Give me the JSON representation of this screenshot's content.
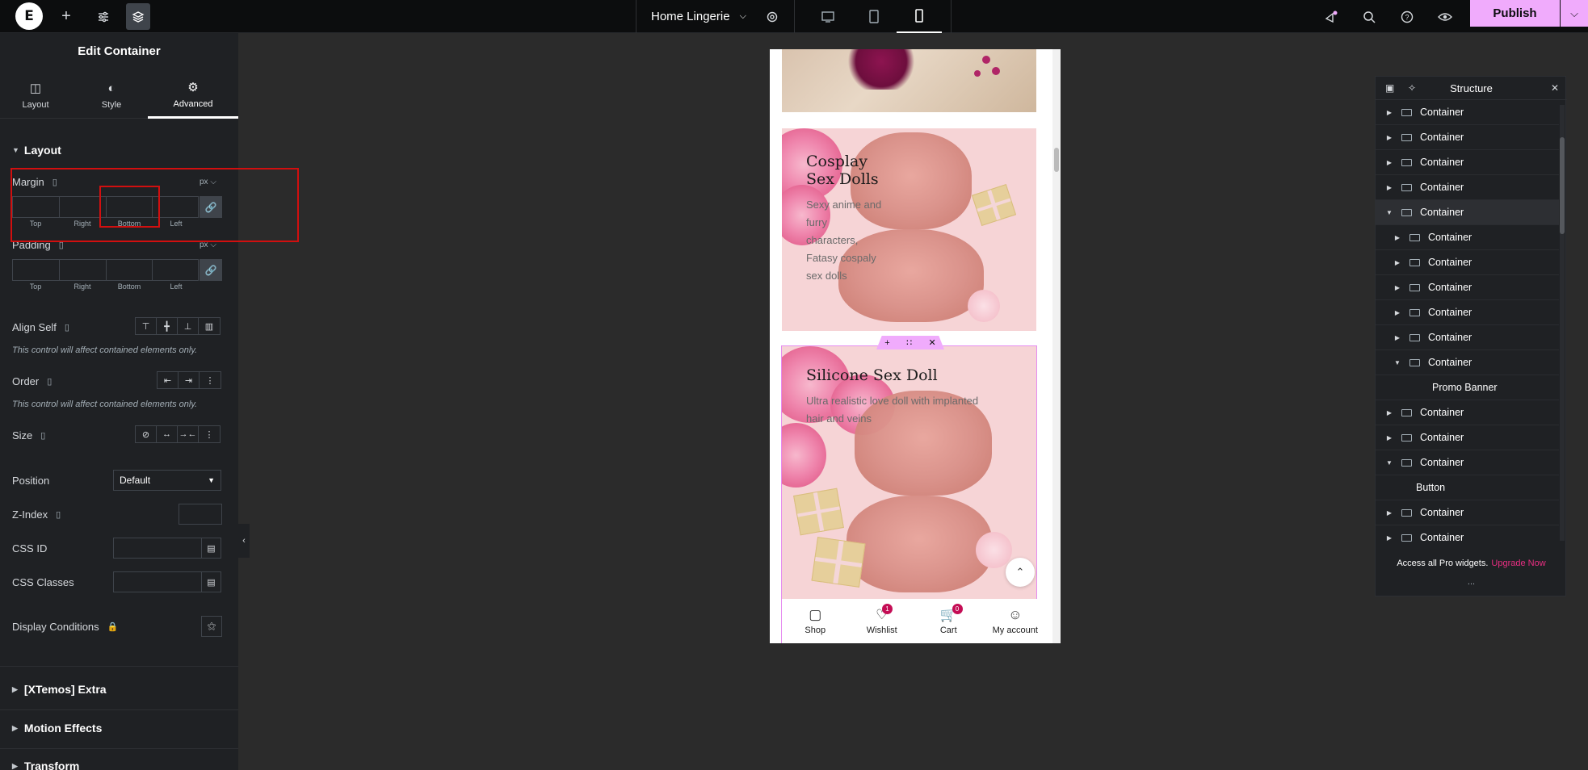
{
  "topbar": {
    "page_title": "Home Lingerie",
    "publish_label": "Publish"
  },
  "panel": {
    "title": "Edit Container",
    "tabs": [
      {
        "label": "Layout",
        "icon": "layout-icon"
      },
      {
        "label": "Style",
        "icon": "style-icon"
      },
      {
        "label": "Advanced",
        "icon": "gear-icon"
      }
    ],
    "section_layout": "Layout",
    "margin": {
      "label": "Margin",
      "unit": "px",
      "sides": [
        "Top",
        "Right",
        "Bottom",
        "Left"
      ]
    },
    "padding": {
      "label": "Padding",
      "unit": "px",
      "sides": [
        "Top",
        "Right",
        "Bottom",
        "Left"
      ]
    },
    "align_self": "Align Self",
    "align_note": "This control will affect contained elements only.",
    "order": "Order",
    "order_note": "This control will affect contained elements only.",
    "size": "Size",
    "position": {
      "label": "Position",
      "value": "Default"
    },
    "z_index": "Z-Index",
    "css_id": "CSS ID",
    "css_classes": "CSS Classes",
    "display_conditions": "Display Conditions",
    "collapsed_sections": [
      "[XTemos] Extra",
      "Motion Effects",
      "Transform"
    ]
  },
  "preview": {
    "card1": {
      "title_line1": "Cosplay",
      "title_line2": "Sex Dolls",
      "desc_lines": [
        "Sexy anime and",
        "furry",
        "characters,",
        "Fatasy cospaly",
        "sex dolls"
      ]
    },
    "card2": {
      "title": "Silicone Sex Doll",
      "desc_line1": "Ultra realistic love doll with implanted",
      "desc_line2": "hair and veins"
    },
    "nav": [
      {
        "label": "Shop",
        "icon": "shop-icon",
        "badge": ""
      },
      {
        "label": "Wishlist",
        "icon": "heart-icon",
        "badge": "1"
      },
      {
        "label": "Cart",
        "icon": "cart-icon",
        "badge": "0"
      },
      {
        "label": "My account",
        "icon": "user-icon",
        "badge": ""
      }
    ]
  },
  "structure": {
    "title": "Structure",
    "rows": [
      {
        "label": "Container",
        "depth": 0,
        "expanded": false
      },
      {
        "label": "Container",
        "depth": 0,
        "expanded": false
      },
      {
        "label": "Container",
        "depth": 0,
        "expanded": false
      },
      {
        "label": "Container",
        "depth": 0,
        "expanded": false
      },
      {
        "label": "Container",
        "depth": 0,
        "expanded": true
      },
      {
        "label": "Container",
        "depth": 1,
        "expanded": false
      },
      {
        "label": "Container",
        "depth": 1,
        "expanded": false
      },
      {
        "label": "Container",
        "depth": 1,
        "expanded": false
      },
      {
        "label": "Container",
        "depth": 1,
        "expanded": false
      },
      {
        "label": "Container",
        "depth": 1,
        "expanded": false
      },
      {
        "label": "Container",
        "depth": 1,
        "expanded": true
      },
      {
        "label": "Promo Banner",
        "depth": 2,
        "expanded": null
      },
      {
        "label": "Container",
        "depth": 0,
        "expanded": false
      },
      {
        "label": "Container",
        "depth": 0,
        "expanded": false
      },
      {
        "label": "Container",
        "depth": 0,
        "expanded": true
      },
      {
        "label": "Button",
        "depth": 1,
        "expanded": null
      },
      {
        "label": "Container",
        "depth": 0,
        "expanded": false
      },
      {
        "label": "Container",
        "depth": 0,
        "expanded": false
      }
    ],
    "footer_text": "Access all Pro widgets.",
    "footer_link": "Upgrade Now",
    "dots": "..."
  }
}
